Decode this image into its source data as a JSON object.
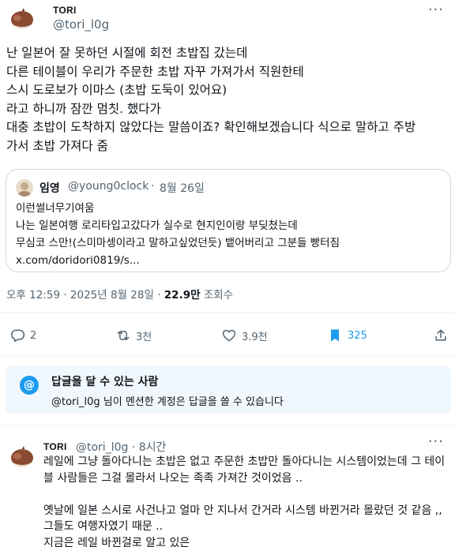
{
  "tweet": {
    "author_name": "TORI",
    "author_handle": "@tori_l0g",
    "text": "난 일본어 잘 못하던 시절에 회전 초밥집 갔는데\n다른 테이블이 우리가 주문한 초밥 자꾸 가져가서 직원한테\n스시 도로보가 이마스 (초밥 도둑이 있어요)\n라고 하니까 잠깐 멈칫. 했다가\n대충 초밥이 도착하지 않았다는 말씀이죠? 확인해보겠습니다 식으로 말하고 주방\n가서 초밥 가져다 줌",
    "timestamp": "오후 12:59 · 2025년 8월 28일",
    "views_count": "22.9만",
    "views_label": "조회수",
    "more_label": "···"
  },
  "quote": {
    "name": "임영",
    "handle": "@young0clock",
    "dot": "·",
    "time": "8월 26일",
    "text": "이런썰너무기여움\n나는 일본여행 로리타입고갔다가 실수로 현지인이랑 부딪쳤는데\n무심코 스만!(스미마셍이라고 말하고싶었던듯) 뱉어버리고 그분들 빵터짐\nx.com/doridori0819/s..."
  },
  "actions": {
    "replies": "2",
    "retweets": "3천",
    "likes": "3.9천",
    "bookmarks": "325"
  },
  "reply_restriction": {
    "title": "답글을 달 수 있는 사람",
    "text": "@tori_l0g 님이 멘션한 계정은 답글을 쓸 수 있습니다",
    "icon_symbol": "@"
  },
  "reply": {
    "author_name": "TORI",
    "author_handle_time": "@tori_l0g · 8시간",
    "more_label": "···",
    "text": "레일에 그냥 돌아다니는 초밥은 없고 주문한 초밥만 돌아다니는 시스템이었는데 그 테이블 사람들은 그걸 몰라서 나오는 족족 가져간 것이었음 ..\n\n옛날에 일본 스시로 사건나고 얼마 안 지나서 간거라 시스템 바뀐거라 몰랐던 것 같음 ,, 그들도 여행자였기 때문 ..\n지금은 레일 바뀐걸로 알고 있은"
  },
  "colors": {
    "text": "#0f1419",
    "secondary": "#536471",
    "accent": "#1d9bf0",
    "border": "#cfd9de",
    "reply_box_bg": "#f0f7fd"
  },
  "icons": {
    "avatar": "chestnut-avatar",
    "reply": "reply-icon",
    "retweet": "retweet-icon",
    "like": "heart-icon",
    "bookmark": "bookmark-icon",
    "share": "share-icon"
  }
}
